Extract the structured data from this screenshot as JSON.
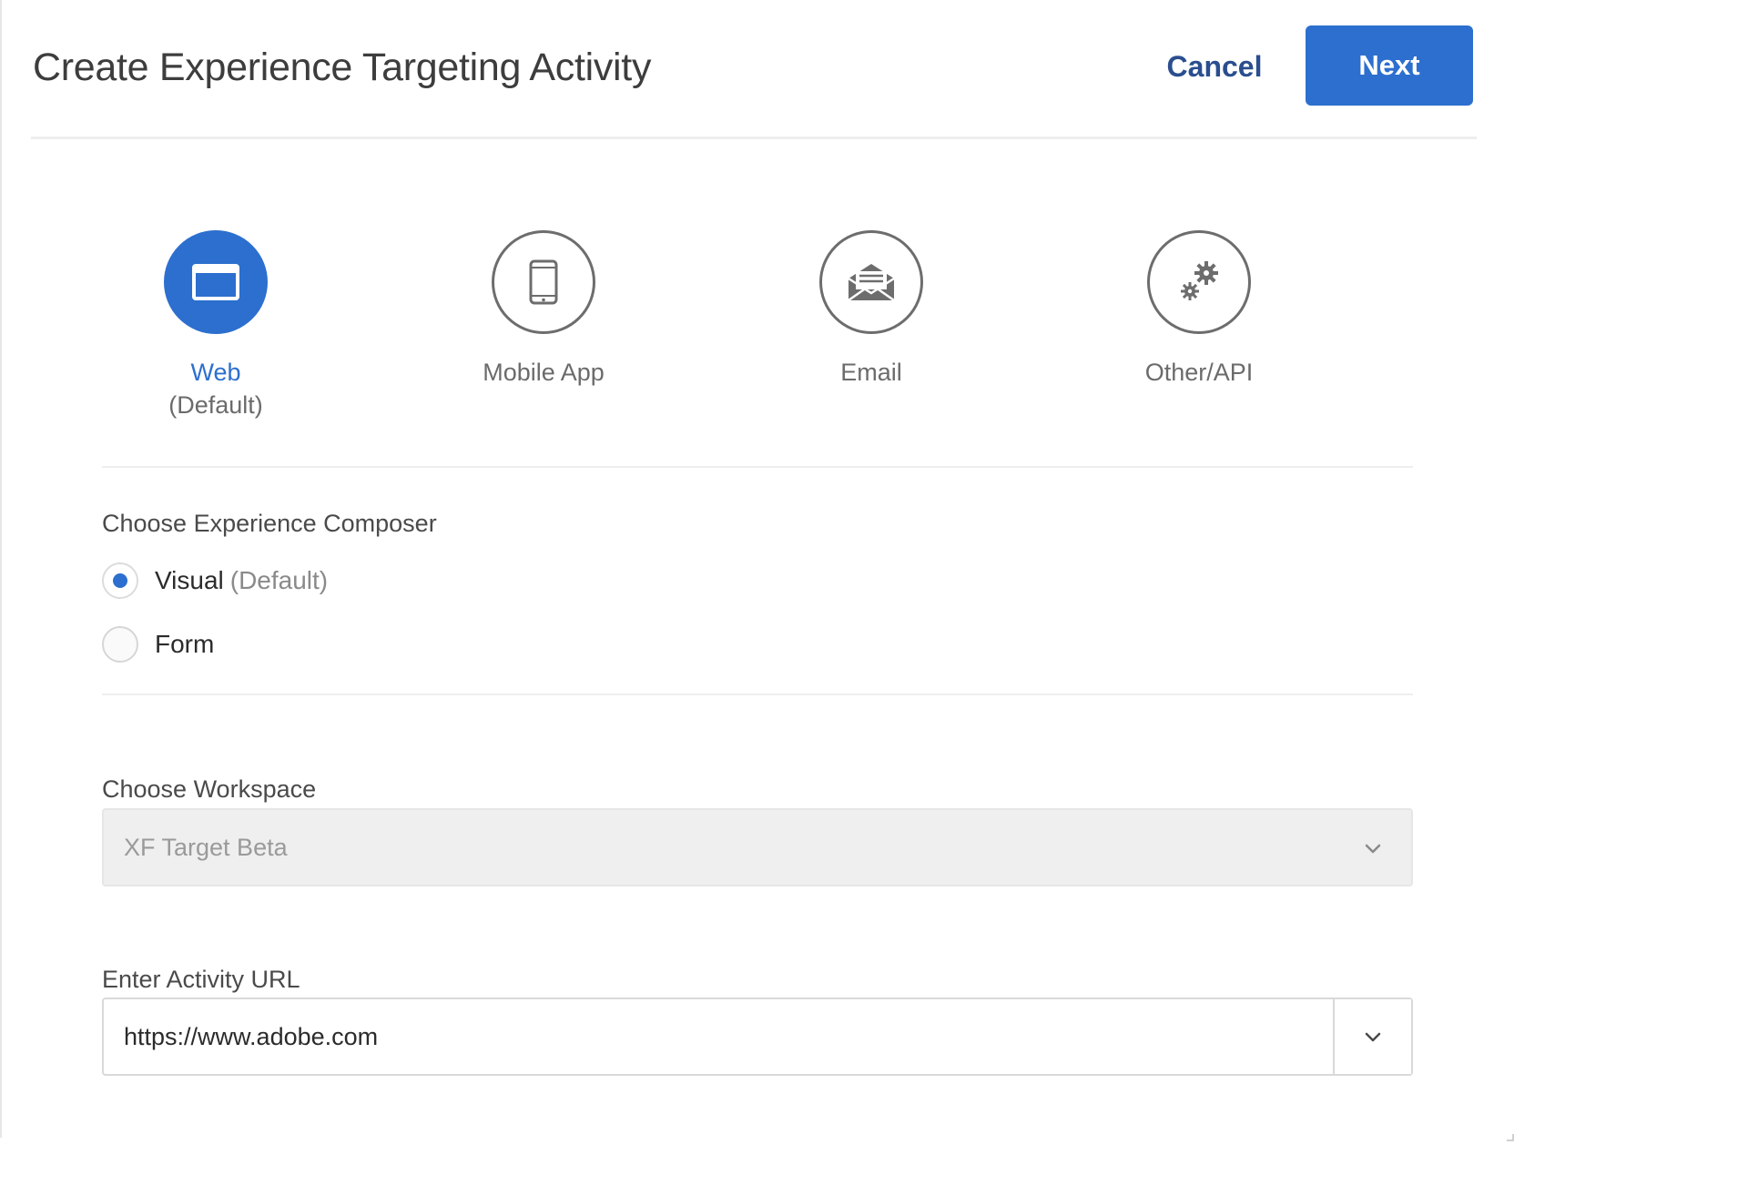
{
  "dialog": {
    "title": "Create Experience Targeting Activity",
    "cancel_label": "Cancel",
    "next_label": "Next"
  },
  "channels": {
    "selected": "web",
    "items": [
      {
        "id": "web",
        "label": "Web",
        "sublabel": "(Default)",
        "icon": "browser-window-icon"
      },
      {
        "id": "mobile",
        "label": "Mobile App",
        "sublabel": "",
        "icon": "mobile-phone-icon"
      },
      {
        "id": "email",
        "label": "Email",
        "sublabel": "",
        "icon": "envelope-icon"
      },
      {
        "id": "other",
        "label": "Other/API",
        "sublabel": "",
        "icon": "gears-icon"
      }
    ]
  },
  "composer": {
    "label": "Choose Experience Composer",
    "options": [
      {
        "label": "Visual",
        "sublabel": "(Default)",
        "checked": true
      },
      {
        "label": "Form",
        "sublabel": "",
        "checked": false
      }
    ]
  },
  "workspace": {
    "label": "Choose Workspace",
    "value": "XF Target Beta"
  },
  "activity_url": {
    "label": "Enter Activity URL",
    "value": "https://www.adobe.com"
  },
  "colors": {
    "accent": "#2c6fce",
    "cancel_text": "#2a4e8e",
    "icon_outline": "#6d6d6d"
  }
}
